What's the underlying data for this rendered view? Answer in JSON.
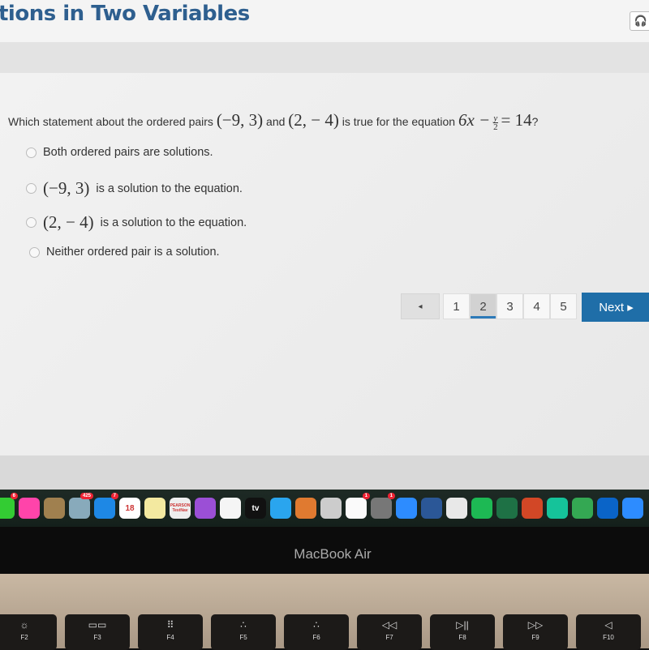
{
  "header": {
    "title": "tions in Two Variables",
    "headset_icon": "headset-icon"
  },
  "question": {
    "text_start": "Which statement about the ordered pairs",
    "pair1": "(−9, 3)",
    "and": "and",
    "pair2": "(2,  − 4)",
    "text_mid": "is true for the equation",
    "eq_left": "6x −",
    "frac_num": "y",
    "frac_den": "2",
    "eq_right": "= 14",
    "qmark": "?"
  },
  "options": [
    {
      "math": "",
      "text": "Both ordered pairs are solutions."
    },
    {
      "math": "(−9, 3)",
      "text": "is a solution to the equation."
    },
    {
      "math": "(2,  − 4)",
      "text": "is a solution to the equation."
    },
    {
      "math": "",
      "text": "Neither ordered pair is a solution."
    }
  ],
  "pagination": {
    "prev": "◂",
    "pages": [
      "1",
      "2",
      "3",
      "4",
      "5"
    ],
    "current": "2",
    "next": "Next ▸"
  },
  "colors": {
    "accent": "#1f6ea8",
    "title": "#2e5f8f"
  },
  "dock": [
    {
      "name": "facetime",
      "color": "#3c3",
      "badge": "6"
    },
    {
      "name": "photos",
      "color": "#f4a",
      "badge": ""
    },
    {
      "name": "notes-brown",
      "color": "#a0804f",
      "badge": ""
    },
    {
      "name": "preview",
      "color": "#8ab",
      "badge": "425"
    },
    {
      "name": "app-store",
      "color": "#1e88e5",
      "badge": "7"
    },
    {
      "name": "calendar",
      "color": "#fff",
      "badge": "",
      "label": "18"
    },
    {
      "name": "notes",
      "color": "#f3e9a0",
      "badge": ""
    },
    {
      "name": "pearson-testnav",
      "color": "#eee",
      "badge": "",
      "label": "PEARSON TestNav"
    },
    {
      "name": "podcasts",
      "color": "#9b4fd6",
      "badge": ""
    },
    {
      "name": "music",
      "color": "#f5f5f5",
      "badge": ""
    },
    {
      "name": "apple-tv",
      "color": "#111",
      "badge": "",
      "label": "tv"
    },
    {
      "name": "messages",
      "color": "#2aa5ee",
      "badge": ""
    },
    {
      "name": "books",
      "color": "#e07a30",
      "badge": ""
    },
    {
      "name": "roblox",
      "color": "#ccc",
      "badge": ""
    },
    {
      "name": "reminders",
      "color": "#fafafa",
      "badge": "1"
    },
    {
      "name": "system-preferences",
      "color": "#777",
      "badge": "1"
    },
    {
      "name": "zoom",
      "color": "#2d8cff",
      "badge": ""
    },
    {
      "name": "word",
      "color": "#2b5797",
      "badge": ""
    },
    {
      "name": "chrome",
      "color": "#e8e8e8",
      "badge": ""
    },
    {
      "name": "spotify",
      "color": "#1db954",
      "badge": ""
    },
    {
      "name": "excel",
      "color": "#1e7145",
      "badge": ""
    },
    {
      "name": "powerpoint",
      "color": "#d24726",
      "badge": ""
    },
    {
      "name": "grammarly",
      "color": "#15c39a",
      "badge": ""
    },
    {
      "name": "google-chat",
      "color": "#34a853",
      "badge": ""
    },
    {
      "name": "outlook",
      "color": "#0a64c8",
      "badge": ""
    },
    {
      "name": "zoom-2",
      "color": "#2d8cff",
      "badge": ""
    }
  ],
  "laptop": {
    "brand": "MacBook Air"
  },
  "keys": [
    {
      "glyph": "☼",
      "label": "F2"
    },
    {
      "glyph": "▭▭",
      "label": "F3"
    },
    {
      "glyph": "⠿",
      "label": "F4"
    },
    {
      "glyph": "∴",
      "label": "F5"
    },
    {
      "glyph": "∴",
      "label": "F6"
    },
    {
      "glyph": "◁◁",
      "label": "F7"
    },
    {
      "glyph": "▷||",
      "label": "F8"
    },
    {
      "glyph": "▷▷",
      "label": "F9"
    },
    {
      "glyph": "◁",
      "label": "F10"
    }
  ]
}
